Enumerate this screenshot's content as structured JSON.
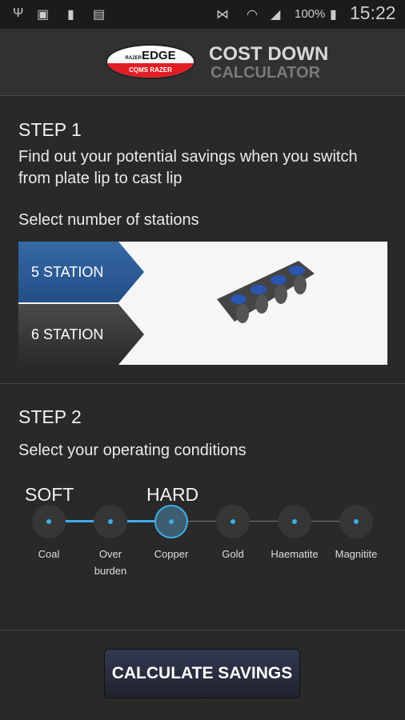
{
  "status_bar": {
    "icons": [
      "usb-icon",
      "image-icon",
      "battery-100-icon",
      "sim-missing-icon",
      "mute-icon",
      "wifi-icon",
      "signal-icon",
      "battery-icon"
    ],
    "battery": "100%",
    "time": "15:22"
  },
  "header": {
    "logo_text": "RAZER EDGE CQMS RAZER",
    "title_line1": "COST DOWN",
    "title_line2": "CALCULATOR"
  },
  "step1": {
    "title": "STEP 1",
    "description": "Find out your potential savings when you switch from plate lip to cast lip",
    "prompt": "Select number of stations",
    "options": [
      {
        "label": "5 STATION",
        "selected": true
      },
      {
        "label": "6 STATION",
        "selected": false
      }
    ]
  },
  "step2": {
    "title": "STEP 2",
    "prompt": "Select your operating conditions",
    "soft_label": "SOFT",
    "hard_label": "HARD",
    "conditions": [
      "Coal",
      "Over burden",
      "Copper",
      "Gold",
      "Haematite",
      "Magnitite"
    ],
    "selected": "Copper"
  },
  "action": {
    "calculate_label": "CALCULATE SAVINGS"
  },
  "colors": {
    "accent": "#3daee9",
    "selected_station": "#2c5c97",
    "brand_red": "#e31d25"
  }
}
